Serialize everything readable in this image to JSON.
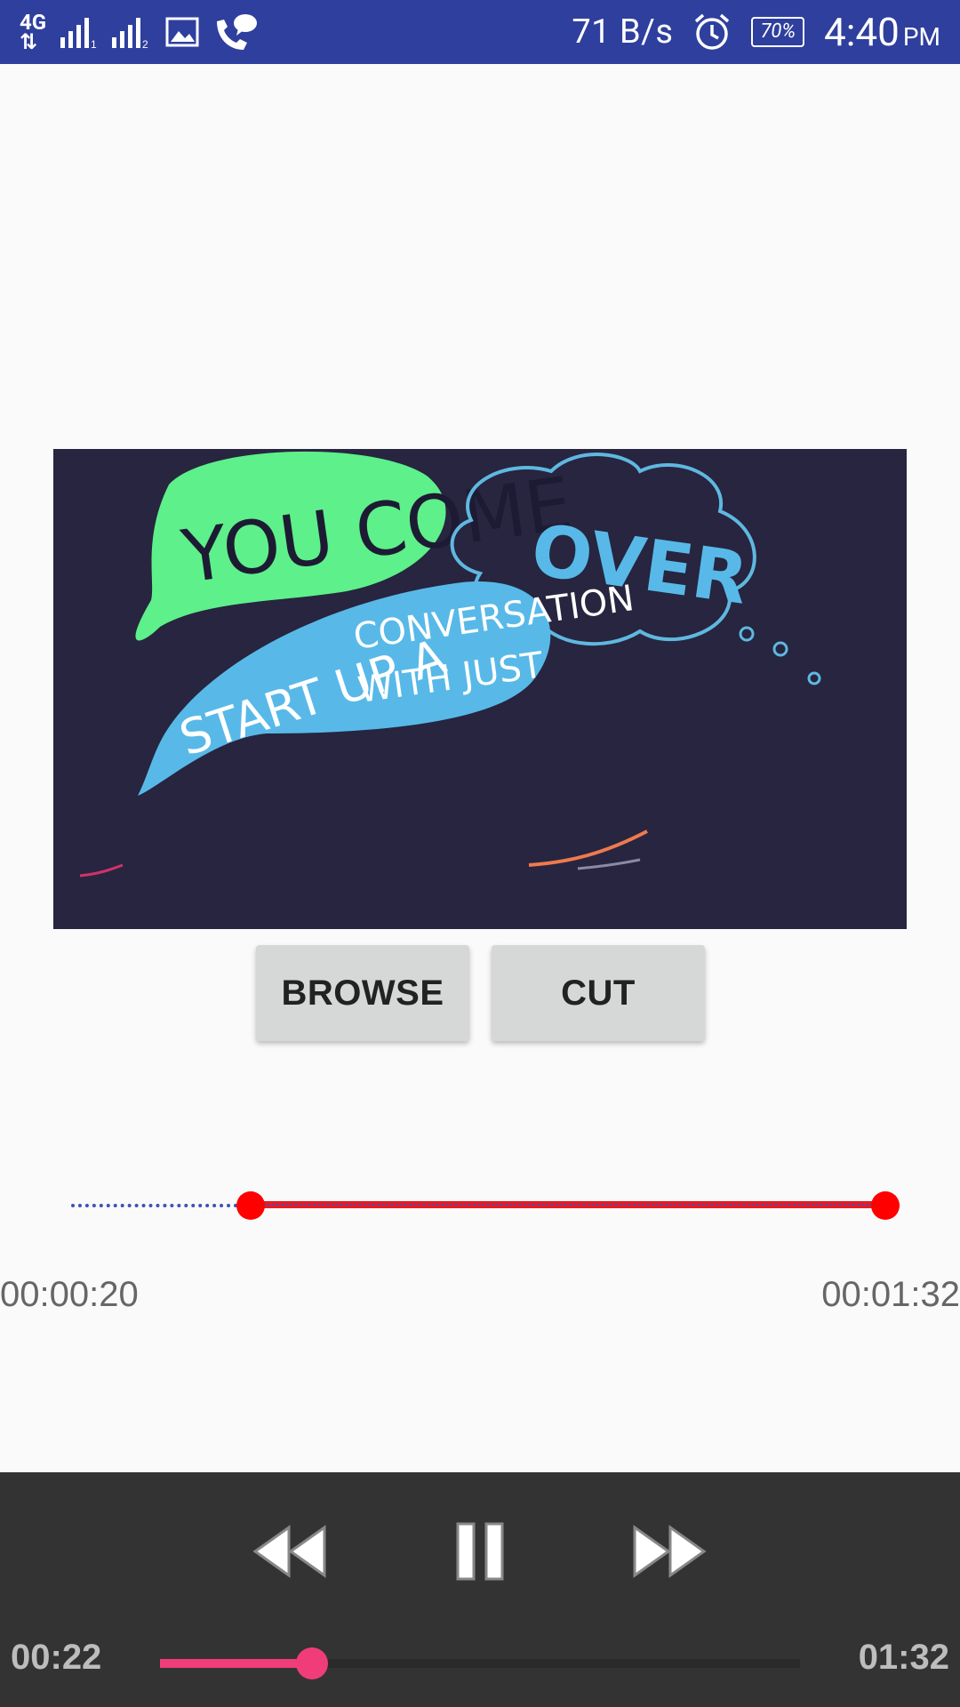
{
  "status_bar": {
    "network_type": "4G",
    "net_speed": "71 B/s",
    "battery": "70%",
    "time": "4:40",
    "ampm": "PM",
    "icons": [
      "4g-icon",
      "signal-sim1-icon",
      "signal-sim2-icon",
      "image-icon",
      "call-chat-icon",
      "alarm-icon"
    ],
    "background_color": "#2f3f9e"
  },
  "video": {
    "lines": [
      "YOU COME",
      "OVER",
      "START UP A",
      "CONVERSATION",
      "WITH JUST"
    ],
    "colors": {
      "background": "#27253f",
      "green_bubble": "#5ef08a",
      "blue_bubble": "#58b9e8"
    }
  },
  "buttons": {
    "browse_label": "BROWSE",
    "cut_label": "CUT"
  },
  "range": {
    "start_time": "00:00:20",
    "end_time": "00:01:32",
    "selected_color": "#e61b23"
  },
  "player": {
    "current_time": "00:22",
    "duration": "01:32",
    "progress": 0.24,
    "icons": [
      "rewind-icon",
      "pause-icon",
      "fast-forward-icon"
    ],
    "accent_color": "#f03d7a"
  }
}
